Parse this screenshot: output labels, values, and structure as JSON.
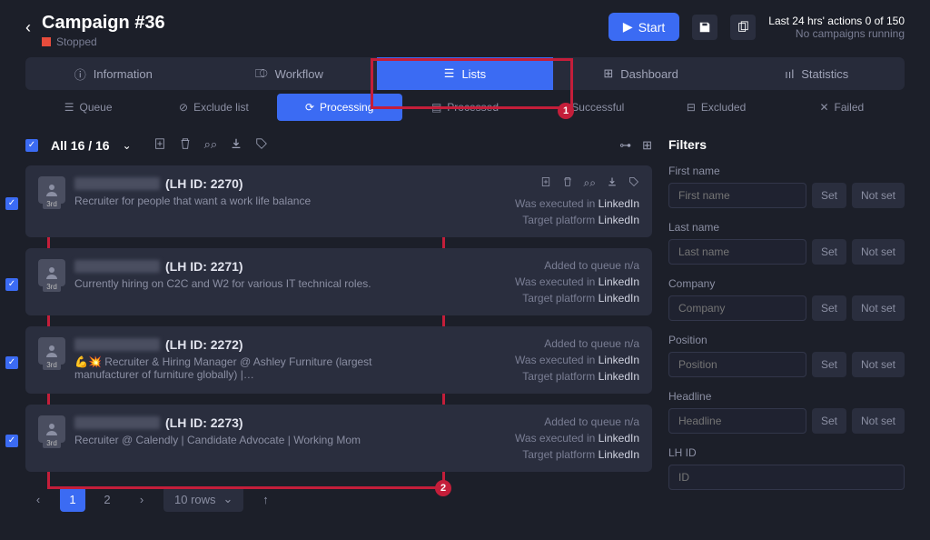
{
  "header": {
    "title": "Campaign #36",
    "status": "Stopped",
    "start_btn": "Start",
    "stats_top": "Last 24 hrs' actions 0 of 150",
    "stats_bottom": "No campaigns running"
  },
  "tabs_primary": {
    "info": "Information",
    "workflow": "Workflow",
    "lists": "Lists",
    "dashboard": "Dashboard",
    "statistics": "Statistics"
  },
  "tabs_secondary": {
    "queue": "Queue",
    "exclude": "Exclude list",
    "processing": "Processing",
    "processed": "Processed",
    "successful": "Successful",
    "excluded": "Excluded",
    "failed": "Failed"
  },
  "toolbar": {
    "count": "All 16 / 16"
  },
  "cards": [
    {
      "lhid": "(LH ID: 2270)",
      "sub": "Recruiter for people that want a work life balance",
      "queue": "",
      "exec": "Was executed in ",
      "exec_b": "LinkedIn",
      "target": "Target platform ",
      "target_b": "LinkedIn",
      "show_actions": true
    },
    {
      "lhid": "(LH ID: 2271)",
      "sub": "Currently hiring on C2C and W2 for various IT technical roles.",
      "queue": "Added to queue n/a",
      "exec": "Was executed in ",
      "exec_b": "LinkedIn",
      "target": "Target platform ",
      "target_b": "LinkedIn",
      "show_actions": false
    },
    {
      "lhid": "(LH ID: 2272)",
      "sub": "💪💥 Recruiter & Hiring Manager @ Ashley Furniture (largest manufacturer of furniture globally) |…",
      "queue": "Added to queue n/a",
      "exec": "Was executed in ",
      "exec_b": "LinkedIn",
      "target": "Target platform ",
      "target_b": "LinkedIn",
      "show_actions": false
    },
    {
      "lhid": "(LH ID: 2273)",
      "sub": "Recruiter @ Calendly | Candidate Advocate | Working Mom",
      "queue": "Added to queue n/a",
      "exec": "Was executed in ",
      "exec_b": "LinkedIn",
      "target": "Target platform ",
      "target_b": "LinkedIn",
      "show_actions": false
    }
  ],
  "pagination": {
    "p1": "1",
    "p2": "2",
    "rows": "10 rows"
  },
  "filters": {
    "title": "Filters",
    "set": "Set",
    "notset": "Not set",
    "first_name": {
      "label": "First name",
      "ph": "First name"
    },
    "last_name": {
      "label": "Last name",
      "ph": "Last name"
    },
    "company": {
      "label": "Company",
      "ph": "Company"
    },
    "position": {
      "label": "Position",
      "ph": "Position"
    },
    "headline": {
      "label": "Headline",
      "ph": "Headline"
    },
    "lh_id": {
      "label": "LH ID",
      "ph": "ID"
    }
  },
  "badge": "3rd",
  "callouts": {
    "one": "1",
    "two": "2"
  }
}
